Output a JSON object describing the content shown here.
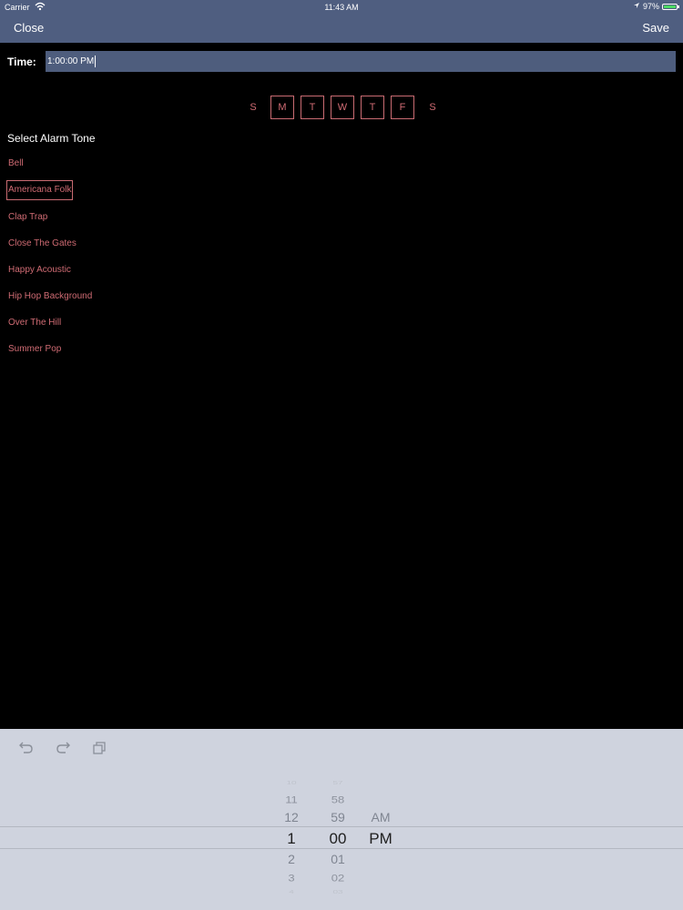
{
  "status_bar": {
    "carrier": "Carrier",
    "time": "11:43 AM",
    "battery": "97%",
    "battery_color": "#4cd964"
  },
  "nav": {
    "close_label": "Close",
    "save_label": "Save"
  },
  "time": {
    "label": "Time:",
    "value": "1:00:00 PM"
  },
  "days": [
    {
      "label": "S",
      "selected": false
    },
    {
      "label": "M",
      "selected": true
    },
    {
      "label": "T",
      "selected": true
    },
    {
      "label": "W",
      "selected": true
    },
    {
      "label": "T",
      "selected": true
    },
    {
      "label": "F",
      "selected": true
    },
    {
      "label": "S",
      "selected": false
    }
  ],
  "tones": {
    "title": "Select Alarm Tone",
    "items": [
      {
        "label": "Bell",
        "selected": false
      },
      {
        "label": "Americana Folk",
        "selected": true
      },
      {
        "label": "Clap Trap",
        "selected": false
      },
      {
        "label": "Close The Gates",
        "selected": false
      },
      {
        "label": "Happy Acoustic",
        "selected": false
      },
      {
        "label": "Hip Hop Background",
        "selected": false
      },
      {
        "label": "Over The Hill",
        "selected": false
      },
      {
        "label": "Summer Pop",
        "selected": false
      }
    ]
  },
  "toolbar_icons": [
    "undo-icon",
    "redo-icon",
    "paste-icon"
  ],
  "picker": {
    "hours": [
      "10",
      "11",
      "12",
      "1",
      "2",
      "3",
      "4"
    ],
    "minutes": [
      "57",
      "58",
      "59",
      "00",
      "01",
      "02",
      "03"
    ],
    "ampm": [
      "AM",
      "PM"
    ],
    "selected_hour": "1",
    "selected_minute": "00",
    "selected_ampm": "PM"
  },
  "colors": {
    "nav_bar": "#4f5e80",
    "accent_red": "#cf6b73",
    "panel": "#cfd3de"
  }
}
